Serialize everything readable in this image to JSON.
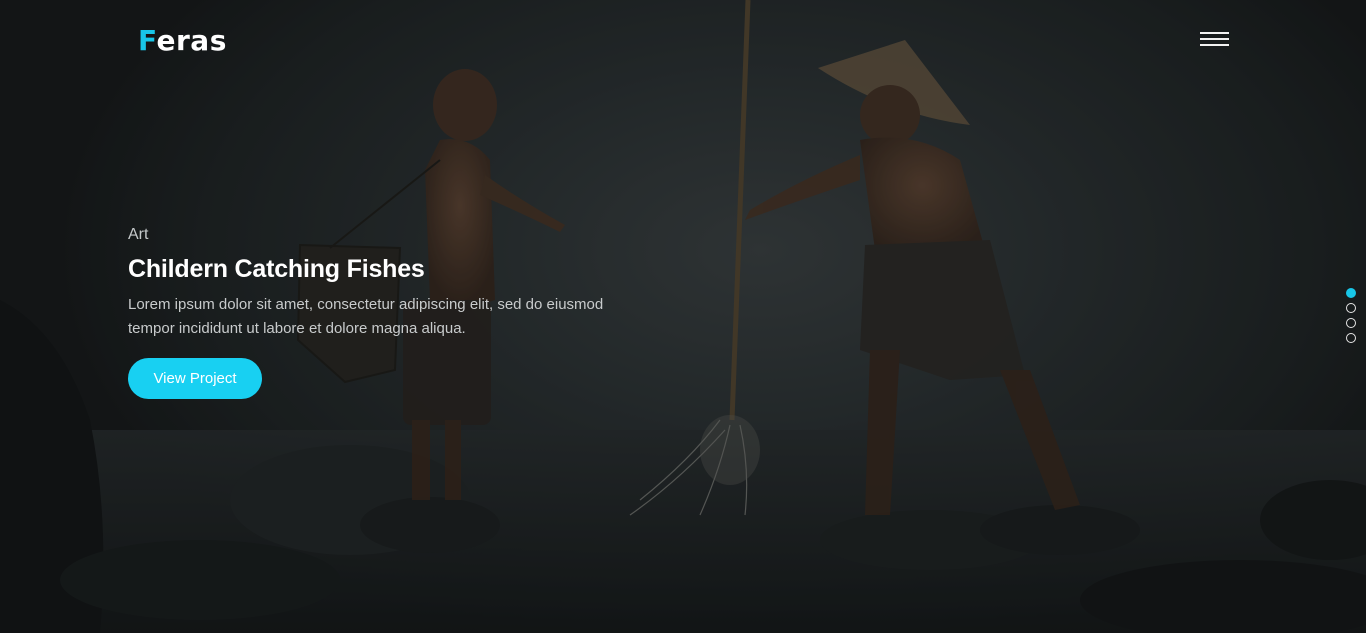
{
  "header": {
    "logo_first": "F",
    "logo_rest": "eras",
    "accent_color": "#18c6e8"
  },
  "menu": {
    "icon": "hamburger-menu-icon"
  },
  "slide": {
    "category": "Art",
    "title": "Childern Catching Fishes",
    "description": "Lorem ipsum dolor sit amet, consectetur adipiscing elit, sed do eiusmod tempor incididunt ut labore et dolore magna aliqua.",
    "button_label": "View Project",
    "button_color": "#18d0f2"
  },
  "slider": {
    "total_slides": 4,
    "active_index": 0
  }
}
